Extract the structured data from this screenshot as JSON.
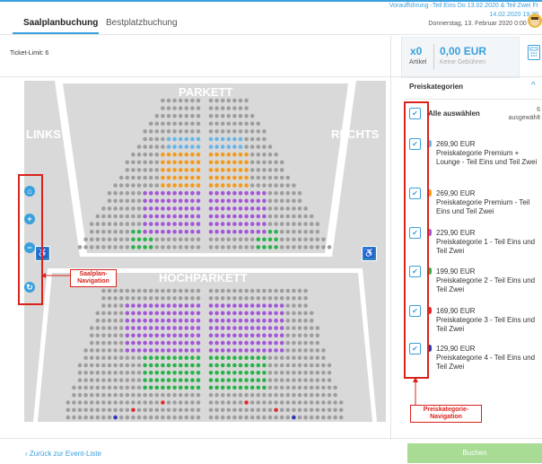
{
  "event": {
    "line1": "Voraufführung -Teil Eins Do 13.02.2020 & Teil Zwei Fr",
    "line2": "14.02.2020 19:30",
    "line3": "Donnerstag, 13. Februar 2020 0:00 Uhr"
  },
  "tabs": [
    {
      "label": "Saalplanbuchung",
      "active": true
    },
    {
      "label": "Bestplatzbuchung",
      "active": false
    }
  ],
  "ticket_limit": "Ticket-Limit: 6",
  "cart": {
    "count": "x0",
    "count_label": "Artikel",
    "price": "0,00 EUR",
    "fee_label": "Keine Gebühren"
  },
  "seatmap": {
    "section_top": "PARKETT",
    "section_bottom": "HOCHPARKETT",
    "side_left": "LINKS",
    "side_right": "RECHTS",
    "nav_icons": [
      "home-icon",
      "zoom-in-icon",
      "zoom-out-icon",
      "reset-icon"
    ],
    "wheelchair_icon": "wheelchair-icon"
  },
  "annotations": {
    "saalplan_nav": [
      "Saalplan-",
      "Navigation"
    ],
    "preiskategorie_nav": [
      "Preiskategorie-",
      "Navigation"
    ]
  },
  "price_categories": {
    "title": "Preiskategorien",
    "select_all_label": "Alle auswählen",
    "selected_count": "6",
    "selected_text": "ausgewählt",
    "items": [
      {
        "price": "269,90 EUR",
        "name": "Preiskategorie Premium + Lounge - Teil Eins und Teil Zwei",
        "color": "#6ab4e8",
        "checked": true
      },
      {
        "price": "269,90 EUR",
        "name": "Preiskategorie Premium - Teil Eins und Teil Zwei",
        "color": "#f49a1c",
        "checked": true
      },
      {
        "price": "229,90 EUR",
        "name": "Preiskategorie 1 - Teil Eins und Teil Zwei",
        "color": "#a457d8",
        "checked": true
      },
      {
        "price": "199,90 EUR",
        "name": "Preiskategorie 2 - Teil Eins und Teil Zwei",
        "color": "#29b34a",
        "checked": true
      },
      {
        "price": "169,90 EUR",
        "name": "Preiskategorie 3 - Teil Eins und Teil Zwei",
        "color": "#e02c2c",
        "checked": true
      },
      {
        "price": "129,90 EUR",
        "name": "Preiskategorie 4 - Teil Eins und Teil Zwei",
        "color": "#2b3bb8",
        "checked": true
      }
    ]
  },
  "footer": {
    "back_link": "‹ Zurück zur Event-Liste",
    "book_button": "Buchen"
  },
  "colors": {
    "accent": "#3aa0dd",
    "seat_unavailable": "#9e9e9e",
    "annotation": "#d9231d",
    "book_button": "#a8dc94"
  }
}
